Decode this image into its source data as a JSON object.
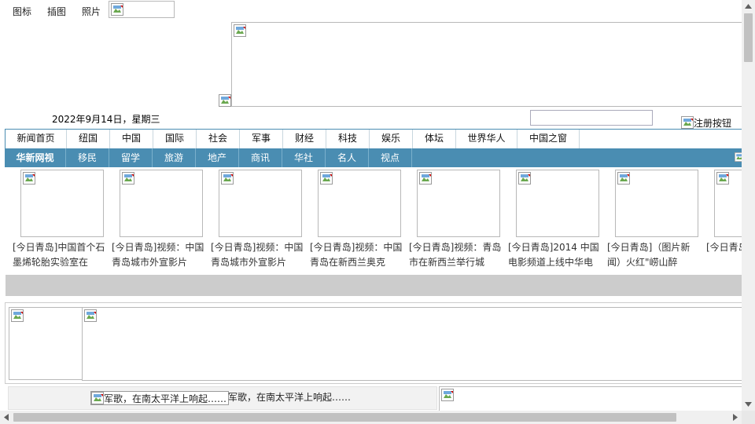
{
  "top_tabs": [
    "图标",
    "插图",
    "照片"
  ],
  "date_text": "2022年9月14日，星期三",
  "search": {
    "value": "",
    "placeholder": ""
  },
  "register_button_alt": "注册按钮",
  "nav_primary": [
    "新闻首页",
    "纽国",
    "中国",
    "国际",
    "社会",
    "军事",
    "财经",
    "科技",
    "娱乐",
    "体坛",
    "世界华人",
    "中国之窗"
  ],
  "nav_secondary": [
    "华新网视",
    "移民",
    "留学",
    "旅游",
    "地产",
    "商讯",
    "华社",
    "名人",
    "视点"
  ],
  "news_items": [
    "[今日青岛]中国首个石墨烯轮胎实验室在",
    "[今日青岛]视频：中国青岛城市外宣影片",
    "[今日青岛]视频：中国青岛城市外宣影片",
    "[今日青岛]视频：中国青岛在新西兰奥克",
    "[今日青岛]视频：青岛市在新西兰举行城",
    "[今日青岛]2014 中国电影频道上线中华电",
    "[今日青岛]（图片新闻）火红\"崂山醉",
    "[今日青岛]链\"（老街"
  ],
  "music": {
    "image_alt": "军歌，在南太平洋上响起……",
    "text": "军歌，在南太平洋上响起……"
  },
  "icons": {
    "broken_image": "broken-image-icon",
    "scroll_up": "arrow-up-icon",
    "scroll_down": "arrow-down-icon",
    "scroll_left": "arrow-left-icon",
    "scroll_right": "arrow-right-icon"
  },
  "colors": {
    "nav_blue": "#4a8db2",
    "grey_bar": "#cccccc"
  }
}
